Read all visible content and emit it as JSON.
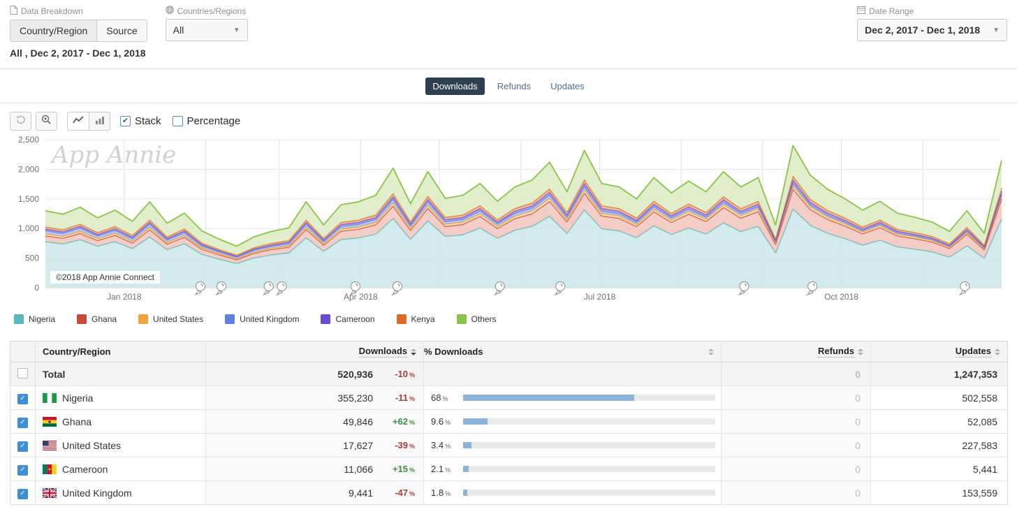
{
  "toolbar_top": {
    "data_breakdown_label": "Data Breakdown",
    "breakdown_options": [
      "Country/Region",
      "Source"
    ],
    "breakdown_active": "Country/Region",
    "countries_label": "Countries/Regions",
    "countries_value": "All",
    "date_range_label": "Date Range",
    "date_range_value": "Dec 2, 2017 - Dec 1, 2018"
  },
  "subtitle": "All , Dec 2, 2017 - Dec 1, 2018",
  "tabs": {
    "items": [
      "Downloads",
      "Refunds",
      "Updates"
    ],
    "active": "Downloads"
  },
  "chart_controls": {
    "stack_label": "Stack",
    "percentage_label": "Percentage",
    "stack_checked": true,
    "percentage_checked": false
  },
  "chart_data": {
    "type": "area",
    "stacked": true,
    "watermark": "App Annie",
    "copyright": "©2018 App Annie Connect",
    "x_range": [
      "Dec 2, 2017",
      "Dec 1, 2018"
    ],
    "days_total": 364,
    "ylim": [
      0,
      2500
    ],
    "yticks": [
      {
        "label": "0",
        "value": 0
      },
      {
        "label": "500",
        "value": 500
      },
      {
        "label": "1,000",
        "value": 1000
      },
      {
        "label": "1,500",
        "value": 1500
      },
      {
        "label": "2,000",
        "value": 2000
      },
      {
        "label": "2,500",
        "value": 2500
      }
    ],
    "x_ticks": [
      {
        "label": "Jan 2018",
        "day": 30
      },
      {
        "label": "Apr 2018",
        "day": 120
      },
      {
        "label": "Jul 2018",
        "day": 211
      },
      {
        "label": "Oct 2018",
        "day": 303
      }
    ],
    "x_gridline_days": [
      30,
      61,
      89,
      120,
      150,
      181,
      211,
      242,
      273,
      303,
      334
    ],
    "event_marker_days": [
      59,
      67,
      85,
      90,
      118,
      134,
      173,
      196,
      266,
      292,
      350
    ],
    "totals_weekly": [
      1300,
      1240,
      1360,
      1180,
      1310,
      1120,
      1450,
      1090,
      1260,
      960,
      820,
      700,
      860,
      950,
      1010,
      1450,
      1060,
      1400,
      1450,
      1560,
      2020,
      1420,
      1960,
      1510,
      1560,
      1760,
      1460,
      1700,
      1820,
      2120,
      1620,
      2320,
      1760,
      1700,
      1500,
      1860,
      1600,
      1800,
      1620,
      1960,
      1700,
      1860,
      1060,
      2400,
      1900,
      1660,
      1500,
      1310,
      1460,
      1260,
      1190,
      1110,
      950,
      1300,
      920,
      2150
    ],
    "series": [
      {
        "name": "Nigeria",
        "color": "#5bb7bc",
        "fill": "#cde8e9",
        "share_start": 0.6,
        "share_end": 0.545
      },
      {
        "name": "Ghana",
        "color": "#c94a3b",
        "fill": "#f2c6bf",
        "share_start": 0.075,
        "share_end": 0.155
      },
      {
        "name": "United States",
        "color": "#eda33f",
        "fill": "#f6d9a8",
        "share_start": 0.027,
        "share_end": 0.025
      },
      {
        "name": "United Kingdom",
        "color": "#5f82de",
        "fill": "#aebdf0",
        "share_start": 0.042,
        "share_end": 0.013
      },
      {
        "name": "Cameroon",
        "color": "#6a4ad4",
        "fill": "#b3a4ec",
        "share_start": 0.02,
        "share_end": 0.02
      },
      {
        "name": "Kenya",
        "color": "#dd6b27",
        "fill": "#f0b58c",
        "share_start": 0.028,
        "share_end": 0.027
      },
      {
        "name": "Others",
        "color": "#8bc34a",
        "fill": "#dcecc4",
        "share_start": 0.208,
        "share_end": 0.215
      }
    ]
  },
  "table": {
    "headers": {
      "country": "Country/Region",
      "downloads": "Downloads",
      "pct_downloads": "% Downloads",
      "refunds": "Refunds",
      "updates": "Updates"
    },
    "total_row": {
      "label": "Total",
      "downloads": "520,936",
      "change": "-10",
      "change_dir": "neg",
      "refunds": "0",
      "updates": "1,247,353"
    },
    "rows": [
      {
        "country": "Nigeria",
        "flag": "nigeria",
        "checked": true,
        "downloads": "355,230",
        "change": "-11",
        "change_dir": "neg",
        "pct": "68",
        "pct_value": 68,
        "refunds": "0",
        "updates": "502,558"
      },
      {
        "country": "Ghana",
        "flag": "ghana",
        "checked": true,
        "downloads": "49,846",
        "change": "+62",
        "change_dir": "pos",
        "pct": "9.6",
        "pct_value": 9.6,
        "refunds": "0",
        "updates": "52,085"
      },
      {
        "country": "United States",
        "flag": "us",
        "checked": true,
        "downloads": "17,627",
        "change": "-39",
        "change_dir": "neg",
        "pct": "3.4",
        "pct_value": 3.4,
        "refunds": "0",
        "updates": "227,583"
      },
      {
        "country": "Cameroon",
        "flag": "cameroon",
        "checked": true,
        "downloads": "11,066",
        "change": "+15",
        "change_dir": "pos",
        "pct": "2.1",
        "pct_value": 2.1,
        "refunds": "0",
        "updates": "5,441"
      },
      {
        "country": "United Kingdom",
        "flag": "uk",
        "checked": true,
        "downloads": "9,441",
        "change": "-47",
        "change_dir": "neg",
        "pct": "1.8",
        "pct_value": 1.8,
        "refunds": "0",
        "updates": "153,559"
      }
    ]
  }
}
